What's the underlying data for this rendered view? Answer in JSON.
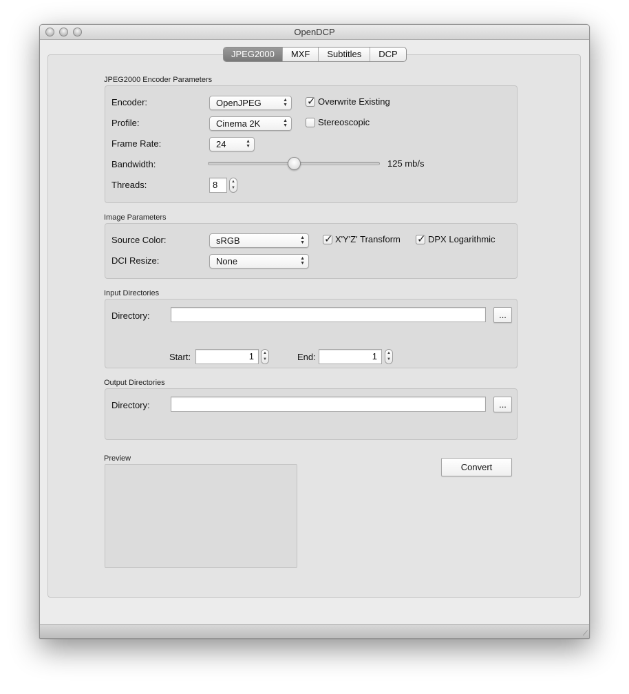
{
  "window": {
    "title": "OpenDCP"
  },
  "tabs": [
    "JPEG2000",
    "MXF",
    "Subtitles",
    "DCP"
  ],
  "encoder_params": {
    "title": "JPEG2000 Encoder Parameters",
    "encoder_label": "Encoder:",
    "encoder_value": "OpenJPEG",
    "overwrite_label": "Overwrite Existing",
    "overwrite_checked": true,
    "profile_label": "Profile:",
    "profile_value": "Cinema 2K",
    "stereoscopic_label": "Stereoscopic",
    "stereoscopic_checked": false,
    "frame_rate_label": "Frame Rate:",
    "frame_rate_value": "24",
    "bandwidth_label": "Bandwidth:",
    "bandwidth_value": "125 mb/s",
    "bandwidth_slider_fraction": 0.5,
    "threads_label": "Threads:",
    "threads_value": "8"
  },
  "image_params": {
    "title": "Image Parameters",
    "source_color_label": "Source Color:",
    "source_color_value": "sRGB",
    "xyz_label": "X'Y'Z' Transform",
    "xyz_checked": true,
    "dpx_label": "DPX Logarithmic",
    "dpx_checked": true,
    "dci_resize_label": "DCI Resize:",
    "dci_resize_value": "None"
  },
  "input_dirs": {
    "title": "Input Directories",
    "directory_label": "Directory:",
    "directory_value": "",
    "browse_label": "...",
    "start_label": "Start:",
    "start_value": "1",
    "end_label": "End:",
    "end_value": "1"
  },
  "output_dirs": {
    "title": "Output Directories",
    "directory_label": "Directory:",
    "directory_value": "",
    "browse_label": "..."
  },
  "preview": {
    "title": "Preview"
  },
  "convert_label": "Convert"
}
